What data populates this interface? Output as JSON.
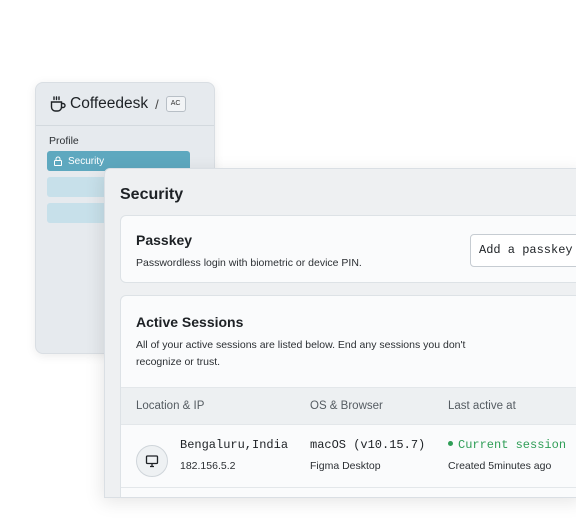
{
  "sidebar": {
    "brand": "Coffeedesk",
    "separator": "/",
    "org_badge": "AC",
    "section_label": "Profile",
    "active_item": "Security",
    "brand_icon": "coffee-cup-icon",
    "active_icon": "lock-icon"
  },
  "panel": {
    "title": "Security"
  },
  "passkey": {
    "title": "Passkey",
    "description": "Passwordless login with biometric or device PIN.",
    "button_label": "Add a passkey"
  },
  "sessions": {
    "title": "Active Sessions",
    "description_line1": "All of your active sessions are listed below. End any sessions you don't",
    "description_line2": "recognize or trust.",
    "columns": [
      "Location & IP",
      "OS & Browser",
      "Last active at"
    ],
    "rows": [
      {
        "icon": "monitor-icon",
        "location": "Bengaluru,India",
        "ip": "182.156.5.2",
        "os": "macOS (v10.15.7)",
        "browser": "Figma Desktop",
        "status": "Current session",
        "created": "Created 5minutes ago"
      }
    ]
  },
  "colors": {
    "accent": "#5ea8bf",
    "accent_light": "#c7e0ea",
    "success": "#2f9e57"
  }
}
